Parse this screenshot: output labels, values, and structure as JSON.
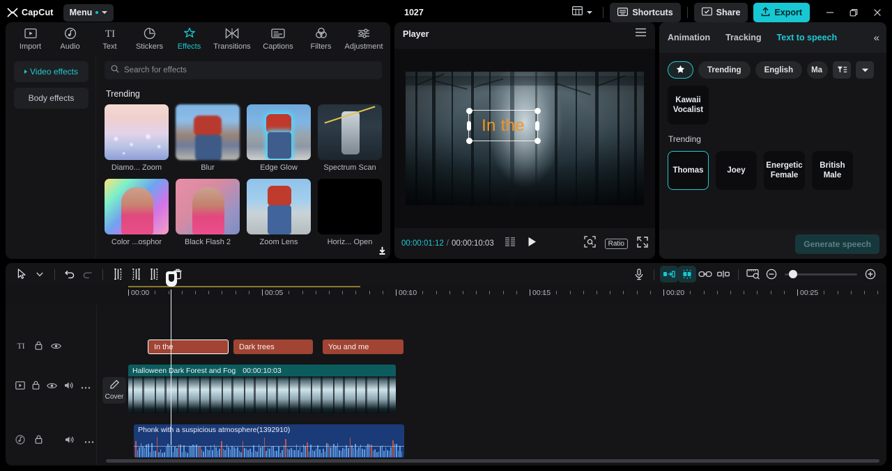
{
  "titlebar": {
    "brand": "CapCut",
    "menu_label": "Menu",
    "project_name": "1027",
    "layout_icon": "layout-icon",
    "shortcuts_label": "Shortcuts",
    "share_label": "Share",
    "export_label": "Export",
    "window_minimize": "minimize-icon",
    "window_restore": "restore-icon",
    "window_close": "close-icon",
    "accent": "#17c8d4"
  },
  "left_panel": {
    "tabs": [
      {
        "label": "Import",
        "icon": "import-icon",
        "active": false
      },
      {
        "label": "Audio",
        "icon": "audio-icon",
        "active": false
      },
      {
        "label": "Text",
        "icon": "text-icon",
        "active": false
      },
      {
        "label": "Stickers",
        "icon": "stickers-icon",
        "active": false
      },
      {
        "label": "Effects",
        "icon": "effects-icon",
        "active": true
      },
      {
        "label": "Transitions",
        "icon": "transitions-icon",
        "active": false
      },
      {
        "label": "Captions",
        "icon": "captions-icon",
        "active": false
      },
      {
        "label": "Filters",
        "icon": "filters-icon",
        "active": false
      },
      {
        "label": "Adjustment",
        "icon": "adjustment-icon",
        "active": false
      }
    ],
    "categories": [
      {
        "label": "Video effects",
        "active": true
      },
      {
        "label": "Body effects",
        "active": false
      }
    ],
    "search": {
      "placeholder": "Search for effects",
      "value": "",
      "icon": "search-icon"
    },
    "section_title": "Trending",
    "effects": [
      {
        "name": "Diamo... Zoom",
        "download": false
      },
      {
        "name": "Blur",
        "download": false
      },
      {
        "name": "Edge Glow",
        "download": false
      },
      {
        "name": "Spectrum Scan",
        "download": true
      },
      {
        "name": "Color ...osphor",
        "download": true
      },
      {
        "name": "Black Flash 2",
        "download": true
      },
      {
        "name": "Zoom Lens",
        "download": false
      },
      {
        "name": "Horiz... Open",
        "download": true
      }
    ]
  },
  "player": {
    "title": "Player",
    "menu_icon": "hamburger-icon",
    "overlay_text": "In the",
    "overlay_text_color": "#f7941d",
    "current_time": "00:00:01:12",
    "time_separator": "/",
    "total_time": "00:00:10:03",
    "controls": [
      {
        "name": "frames-icon"
      },
      {
        "name": "play-icon"
      },
      {
        "name": "crop-icon"
      },
      {
        "name": "ratio-label",
        "label": "Ratio"
      },
      {
        "name": "fullscreen-icon"
      }
    ]
  },
  "right_panel": {
    "tabs": [
      {
        "label": "Animation",
        "active": false
      },
      {
        "label": "Tracking",
        "active": false
      },
      {
        "label": "Text to speech",
        "active": true
      }
    ],
    "collapse_icon": "collapse-chevrons-icon",
    "filters": [
      {
        "label": "",
        "icon": "star-icon",
        "type": "star",
        "active": true
      },
      {
        "label": "Trending",
        "type": "chip"
      },
      {
        "label": "English",
        "type": "chip"
      },
      {
        "label": "Ma",
        "type": "chip-clipped"
      },
      {
        "label": "",
        "icon": "filter-icon",
        "type": "button"
      },
      {
        "label": "",
        "icon": "chevron-down-icon",
        "type": "button"
      }
    ],
    "favorite_voices": [
      {
        "label": "Kawaii Vocalist",
        "selected": false
      }
    ],
    "section_title": "Trending",
    "voices": [
      {
        "label": "Thomas",
        "selected": true
      },
      {
        "label": "Joey",
        "selected": false
      },
      {
        "label": "Energetic Female",
        "selected": false
      },
      {
        "label": "British Male",
        "selected": false
      }
    ],
    "generate_label": "Generate speech"
  },
  "timeline": {
    "toolbar_left": [
      {
        "name": "select-tool-icon"
      },
      {
        "name": "tool-dropdown-caret-icon"
      },
      {
        "name": "undo-icon",
        "dim": false
      },
      {
        "name": "redo-icon",
        "dim": true
      },
      {
        "name": "split-icon"
      },
      {
        "name": "trim-left-icon"
      },
      {
        "name": "trim-right-icon"
      },
      {
        "name": "delete-icon"
      }
    ],
    "toolbar_right": [
      {
        "name": "microphone-icon",
        "active": false
      },
      {
        "name": "mirror-icon",
        "active": true
      },
      {
        "name": "freeze-icon",
        "active": true
      },
      {
        "name": "link-icon",
        "active": false
      },
      {
        "name": "keyframe-icon",
        "active": false
      },
      {
        "name": "preview-size-icon",
        "active": false
      },
      {
        "name": "zoom-out-icon",
        "active": false
      },
      {
        "name": "zoom-in-icon",
        "active": false
      }
    ],
    "ruler_labels": [
      "00:00",
      "00:05",
      "00:10",
      "00:15",
      "00:20",
      "00:25"
    ],
    "playhead_time": "00:00:01:12",
    "text_track": {
      "icon": "text-track-icon",
      "lock_icon": "lock-icon",
      "eye_icon": "eye-icon",
      "clips": [
        {
          "label": "In the",
          "selected": true
        },
        {
          "label": "Dark trees",
          "selected": false
        },
        {
          "label": "You and me",
          "selected": false
        }
      ]
    },
    "video_track": {
      "icon": "video-track-icon",
      "lock_icon": "lock-icon",
      "eye_icon": "eye-icon",
      "volume_icon": "volume-icon",
      "more_icon": "more-icon",
      "cover_label": "Cover",
      "cover_icon": "pencil-icon",
      "clip_name": "Halloween Dark Forest and Fog",
      "clip_duration": "00:00:10:03"
    },
    "audio_track": {
      "icon": "audio-track-icon",
      "lock_icon": "lock-icon",
      "volume_icon": "volume-icon",
      "more_icon": "more-icon",
      "clip_name": "Phonk with a suspicious atmosphere(1392910)"
    }
  }
}
